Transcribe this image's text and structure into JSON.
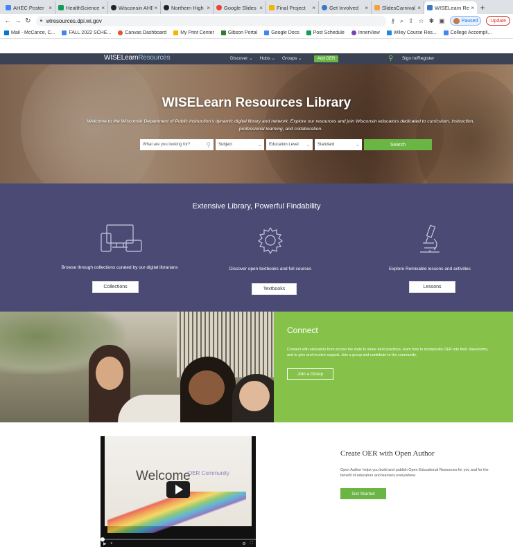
{
  "browser": {
    "tabs": [
      {
        "title": "AHEC Poster",
        "color": "#4285f4"
      },
      {
        "title": "HealthScience",
        "color": "#0f9d58"
      },
      {
        "title": "Wisconsin AHE",
        "color": "#222222"
      },
      {
        "title": "Northern High",
        "color": "#222222"
      },
      {
        "title": "Google Slides",
        "color": "#ea4335"
      },
      {
        "title": "Final Project",
        "color": "#f4b400"
      },
      {
        "title": "Get Involved",
        "color": "#3b78c2"
      },
      {
        "title": "SlidesCarnival",
        "color": "#f4a23a"
      },
      {
        "title": "WISELearn Re",
        "color": "#3b78c2"
      }
    ],
    "url": "wlresources.dpi.wi.gov",
    "profile_label": "Paused",
    "update_label": "Update",
    "bookmarks": [
      {
        "label": "Mail - McCance, C...",
        "color": "#0078d4"
      },
      {
        "label": "FALL 2022 SCHE...",
        "color": "#4285f4"
      },
      {
        "label": "Canvas Dashboard",
        "color": "#e4512c"
      },
      {
        "label": "My Print Center",
        "color": "#f4b400"
      },
      {
        "label": "Gibson Portal",
        "color": "#2e7d32"
      },
      {
        "label": "Google Docs",
        "color": "#4285f4"
      },
      {
        "label": "Post Schedule",
        "color": "#0f9d58"
      },
      {
        "label": "InnerView",
        "color": "#7b3fb5"
      },
      {
        "label": "Wiley Course Res...",
        "color": "#1e88e5"
      },
      {
        "label": "College Accompli...",
        "color": "#4285f4"
      }
    ]
  },
  "site": {
    "logo_bold": "WISELearn",
    "logo_thin": "Resources",
    "nav": [
      "Discover ⌄",
      "Hubs ⌄",
      "Groups ⌄"
    ],
    "add_oer": "Add OER",
    "sign_in": "Sign In/Register"
  },
  "hero": {
    "title": "WISELearn Resources Library",
    "subtitle": "Welcome to the Wisconsin Department of Public Instruction's dynamic digital library and network. Explore our resources and join Wisconsin educators dedicated to curriculum, instruction, professional learning, and collaboration.",
    "search_placeholder": "What are you looking for?",
    "filters": [
      "Subject",
      "Education Level",
      "Standard"
    ],
    "search_button": "Search"
  },
  "features": {
    "title": "Extensive Library, Powerful Findability",
    "items": [
      {
        "text": "Browse through collections curated by our digital librarians",
        "button": "Collections",
        "icon": "devices-icon"
      },
      {
        "text": "Discover open textbooks and full courses",
        "button": "Textbooks",
        "icon": "gear-icon"
      },
      {
        "text": "Explore Remixable lessons and activities",
        "button": "Lessons",
        "icon": "microscope-icon"
      }
    ]
  },
  "connect": {
    "title": "Connect",
    "text": "Connect with educators from across the state to share best practices, learn how to incorporate OER into their classrooms, and to give and receive support. Join a group and contribute to the community.",
    "button": "Join a Group"
  },
  "open_author": {
    "video_welcome": "Welcome",
    "video_sub": "OER Community",
    "title": "Create OER with Open Author",
    "text": "Open Author helps you build and publish Open Educational Resources for you and for the benefit of educators and learners everywhere.",
    "button": "Get Started"
  }
}
